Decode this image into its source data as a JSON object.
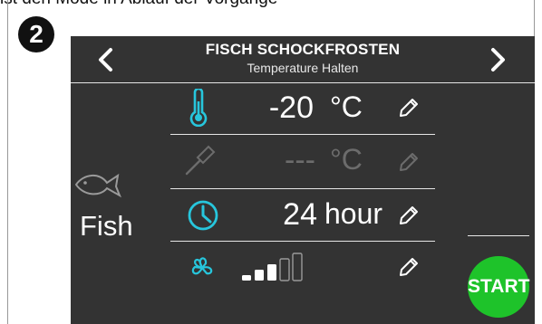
{
  "page": {
    "top_text": "ist den Mode in Ablauf der Vorgänge",
    "step_badge": "2"
  },
  "header": {
    "title": "FISCH SCHOCKFROSTEN",
    "subtitle": "Temperature Halten",
    "prev_icon": "chevron-left-icon",
    "next_icon": "chevron-right-icon"
  },
  "sidebar": {
    "food_label": "Fish",
    "food_icon": "fish-icon"
  },
  "rows": [
    {
      "icon": "thermometer-icon",
      "value": "-20",
      "unit": "°C",
      "edit_icon": "pencil-icon",
      "active": true
    },
    {
      "icon": "core-probe-icon",
      "value": "---",
      "unit": "°C",
      "edit_icon": "pencil-icon",
      "active": false
    },
    {
      "icon": "clock-icon",
      "value": "24",
      "unit": "hour",
      "edit_icon": "pencil-icon",
      "active": true
    },
    {
      "icon": "fan-icon",
      "fan_level": 3,
      "fan_levels_total": 5,
      "edit_icon": "pencil-icon",
      "active": true
    }
  ],
  "start_button": {
    "label": "START"
  },
  "colors": {
    "screen_bg": "#333333",
    "accent_cyan": "#27c6dc",
    "start_green": "#1ec32a",
    "dim_gray": "#6c6c6c"
  }
}
